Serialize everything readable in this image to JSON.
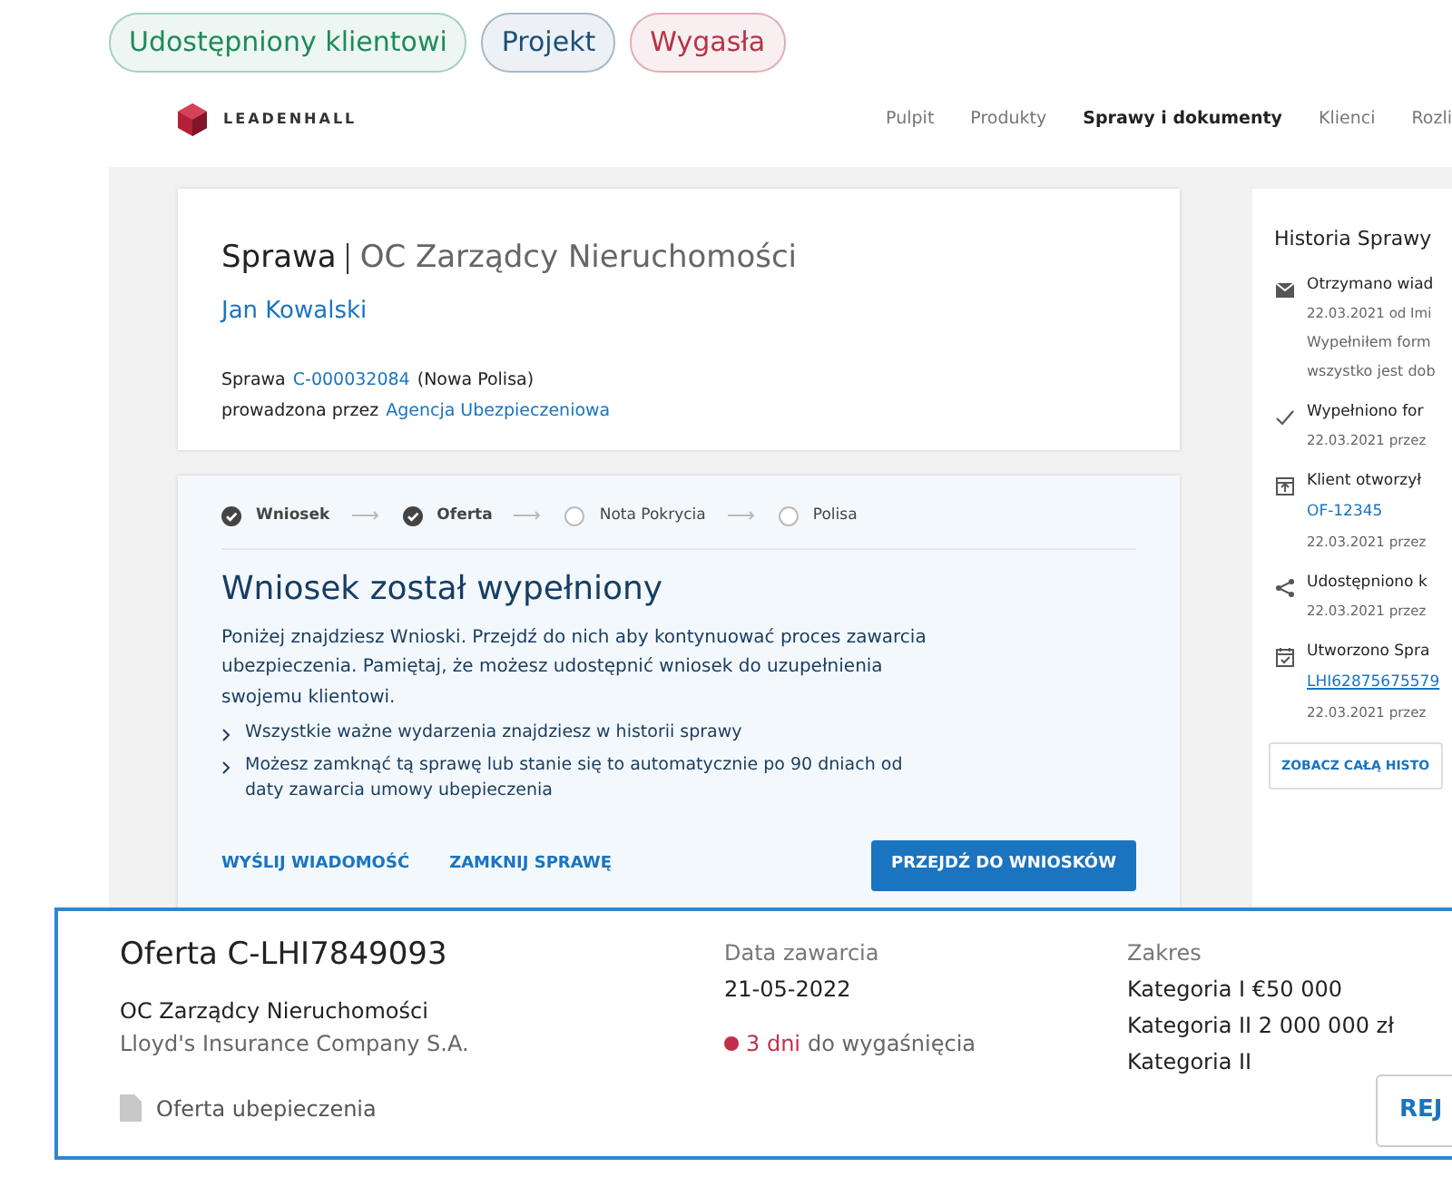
{
  "status_badges": [
    {
      "label": "Udostępniony klientowi",
      "color": "#1e8a5a"
    },
    {
      "label": "Projekt",
      "color": "#1d4f7a"
    },
    {
      "label": "Wygasła",
      "color": "#b83246"
    }
  ],
  "header": {
    "logo": "LEADENHALL",
    "nav": [
      {
        "label": "Pulpit",
        "selected": false
      },
      {
        "label": "Produkty",
        "selected": false
      },
      {
        "label": "Sprawy i dokumenty",
        "selected": true
      },
      {
        "label": "Klienci",
        "selected": false
      },
      {
        "label": "Rozli",
        "selected": false
      }
    ]
  },
  "case": {
    "prefix": "Sprawa",
    "title": "OC Zarządcy Nieruchomości",
    "client": "Jan Kowalski",
    "case_label": "Sprawa",
    "case_id": "C-000032084",
    "case_type": "(Nowa Polisa)",
    "handled_by": "prowadzona przez",
    "agency": "Agencja Ubezpieczeniowa"
  },
  "progress": {
    "steps": [
      {
        "label": "Wniosek",
        "done": true
      },
      {
        "label": "Oferta",
        "done": true
      },
      {
        "label": "Nota Pokrycia",
        "done": false
      },
      {
        "label": "Polisa",
        "done": false
      }
    ],
    "heading": "Wniosek został wypełniony",
    "text": "Poniżej znajdziesz Wnioski. Przejdź do nich aby kontynuować proces zawarcia ubezpieczenia. Pamiętaj, że możesz udostępnić wniosek do uzupełnienia swojemu klientowi.",
    "bullets": [
      "Wszystkie ważne wydarzenia znajdziesz w historii sprawy",
      "Możesz zamknąć tą sprawę lub stanie się to automatycznie po 90 dniach od daty zawarcia umowy ubepieczenia"
    ],
    "actions": [
      "WYŚLIJ WIADOMOŚĆ",
      "ZAMKNIJ SPRAWĘ"
    ],
    "primary_action": "PRZEJDŹ DO WNIOSKÓW"
  },
  "history": {
    "title": "Historia Sprawy",
    "events": [
      {
        "kind": "mail",
        "title": "Otrzymano wiad",
        "meta": "22.03.2021 od Imi",
        "note_lines": [
          "Wypełniłem form",
          "wszystko jest dob"
        ]
      },
      {
        "kind": "check",
        "title": "Wypełniono for",
        "meta": "22.03.2021 przez"
      },
      {
        "kind": "open",
        "title": "Klient otworzył",
        "link": "OF-12345",
        "meta": "22.03.2021 przez"
      },
      {
        "kind": "share",
        "title": "Udostępniono k",
        "meta": "22.03.2021 przez"
      },
      {
        "kind": "calendar",
        "title": "Utworzono Spra",
        "link": "LHI62875675579",
        "meta": "22.03.2021 przez"
      }
    ],
    "button": "ZOBACZ CAŁĄ HISTO"
  },
  "offer": {
    "title": "Oferta C-LHI7849093",
    "product": "OC Zarządcy Nieruchomości",
    "insurer": "Lloyd's Insurance Company S.A.",
    "document": "Oferta ubepieczenia",
    "date_label": "Data zawarcia",
    "date": "21-05-2022",
    "expiry_days": "3 dni",
    "expiry_text": "do wygaśnięcia",
    "scope_label": "Zakres",
    "scope": [
      "Kategoria I €50 000",
      "Kategoria II 2 000 000 zł",
      "Kategoria II"
    ],
    "button": "REJ"
  }
}
